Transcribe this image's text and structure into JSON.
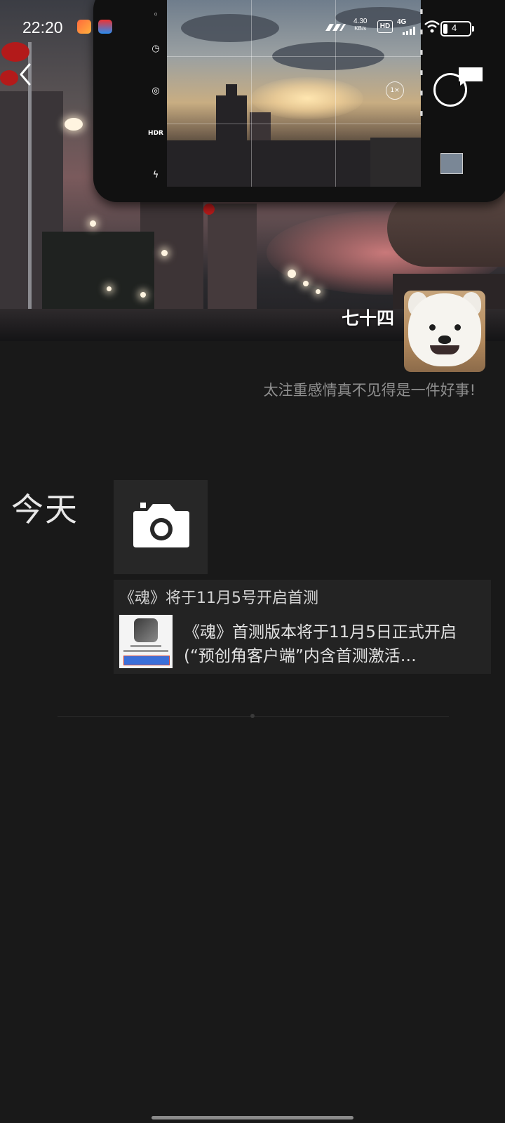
{
  "status_bar": {
    "time": "22:20",
    "net_speed_value": "4.30",
    "net_speed_unit": "KB/s",
    "hd_badge": "HD",
    "network": "4G",
    "battery_level": "4",
    "app_icons": [
      "kuaishou-icon",
      "maps-icon"
    ]
  },
  "cover_photo": {
    "viewfinder_zoom": "1×",
    "hdr_label": "HDR"
  },
  "profile": {
    "nickname": "七十四",
    "signature": "太注重感情真不见得是一件好事!"
  },
  "feed": {
    "date_label": "今天",
    "share_title": "《魂》将于11月5号开启首测",
    "share_desc_line1": "《魂》首测版本将于11月5日正式开启",
    "share_desc_line2": "(“预创角客户端”内含首测激活…"
  },
  "colors": {
    "background": "#191919",
    "signature_text": "#8e8e8e",
    "card_background": "#232323"
  }
}
